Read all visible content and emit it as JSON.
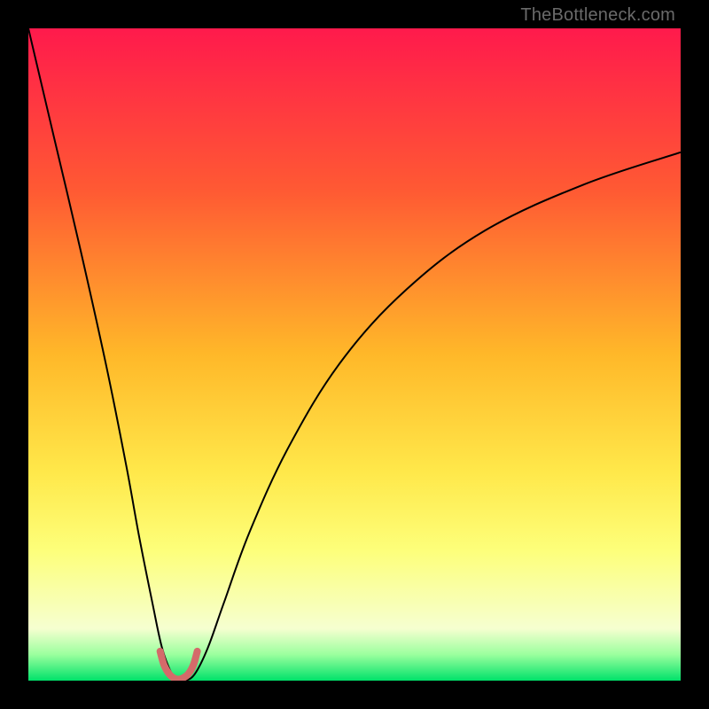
{
  "watermark": "TheBottleneck.com",
  "chart_data": {
    "type": "line",
    "title": "",
    "xlabel": "",
    "ylabel": "",
    "xlim": [
      0,
      100
    ],
    "ylim": [
      0,
      100
    ],
    "legend": false,
    "grid": false,
    "background_gradient": {
      "stops": [
        {
          "pct": 0,
          "color": "#ff1a4c"
        },
        {
          "pct": 25,
          "color": "#ff5a33"
        },
        {
          "pct": 50,
          "color": "#ffb829"
        },
        {
          "pct": 68,
          "color": "#ffe84a"
        },
        {
          "pct": 80,
          "color": "#fdff7a"
        },
        {
          "pct": 92,
          "color": "#f6ffd0"
        },
        {
          "pct": 96,
          "color": "#9bff9e"
        },
        {
          "pct": 100,
          "color": "#00e26a"
        }
      ]
    },
    "series": [
      {
        "name": "bottleneck-curve",
        "color": "#000000",
        "width": 2,
        "x": [
          0,
          4,
          8,
          12,
          15,
          17,
          19,
          20.5,
          22,
          23,
          24,
          25.5,
          27.5,
          30,
          34,
          40,
          48,
          58,
          70,
          85,
          100
        ],
        "y": [
          100,
          83,
          66,
          48,
          33,
          22,
          12,
          5,
          1,
          0,
          0,
          1,
          5,
          12,
          23,
          36,
          49,
          60,
          69,
          76,
          81
        ]
      },
      {
        "name": "ideal-marker",
        "color": "#d46a6a",
        "width": 8,
        "linecap": "round",
        "x": [
          20.2,
          20.8,
          21.6,
          22.3,
          23.0,
          23.7,
          24.5,
          25.3,
          25.9
        ],
        "y": [
          4.5,
          2.4,
          1.0,
          0.4,
          0.2,
          0.4,
          1.0,
          2.4,
          4.5
        ]
      }
    ]
  }
}
